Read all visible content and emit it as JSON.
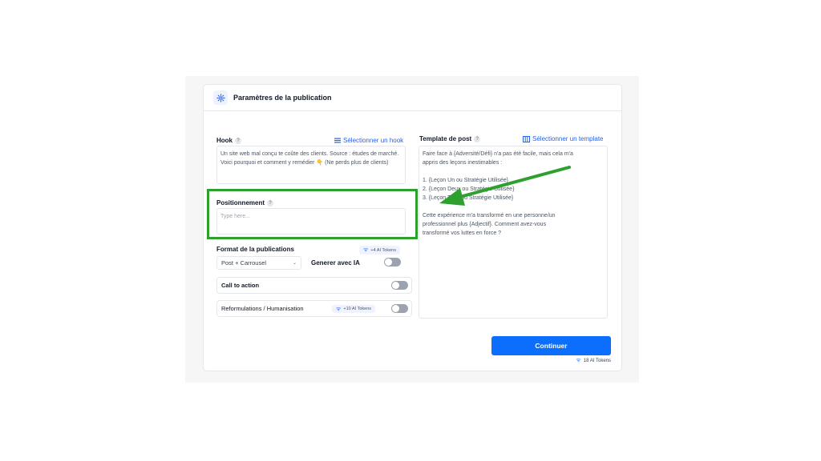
{
  "card": {
    "title": "Paramètres de la publication"
  },
  "hook": {
    "label": "Hook",
    "help": "?",
    "select_link": "Sélectionner un hook",
    "value": "Un site web mal conçu te coûte des clients. Source : études de marché. Voici pourquoi et comment y remédier 👇 (Ne perds plus de clients)"
  },
  "positionnement": {
    "label": "Positionnement",
    "help": "?",
    "placeholder": "Type here..."
  },
  "format": {
    "label": "Format de la publications",
    "token_badge": "+4 AI Tokens",
    "selected": "Post + Carrousel",
    "ia_label": "Generer avec IA"
  },
  "options": {
    "cta_label": "Call to action",
    "reform_label": "Reformulations / Humanisation",
    "reform_badge": "+10 AI Tokens"
  },
  "template": {
    "label": "Template de post",
    "help": "?",
    "select_link": "Sélectionner un template",
    "lines": [
      "Faire face à {Adversité/Défi} n'a pas été facile, mais cela m'a",
      "appris des leçons inestimables :",
      "",
      "1. {Leçon Un ou Stratégie Utilisée}",
      "2. {Leçon Deux ou Stratégie Utilisée}",
      "3. {Leçon Trois ou Stratégie Utilisée}",
      "",
      "Cette expérience m'a transformé en une personne/un",
      "professionnel plus {Adjectif}. Comment avez-vous",
      "transformé vos luttes en force ?"
    ]
  },
  "actions": {
    "continue_label": "Continuer",
    "total_tokens": "18 AI Tokens"
  },
  "colors": {
    "accent": "#0b6efd",
    "highlight": "#2ea02e"
  },
  "icons": {
    "header": "gear-icon",
    "hook_link": "list-icon",
    "template_link": "columns-icon",
    "token": "wifi-icon"
  }
}
